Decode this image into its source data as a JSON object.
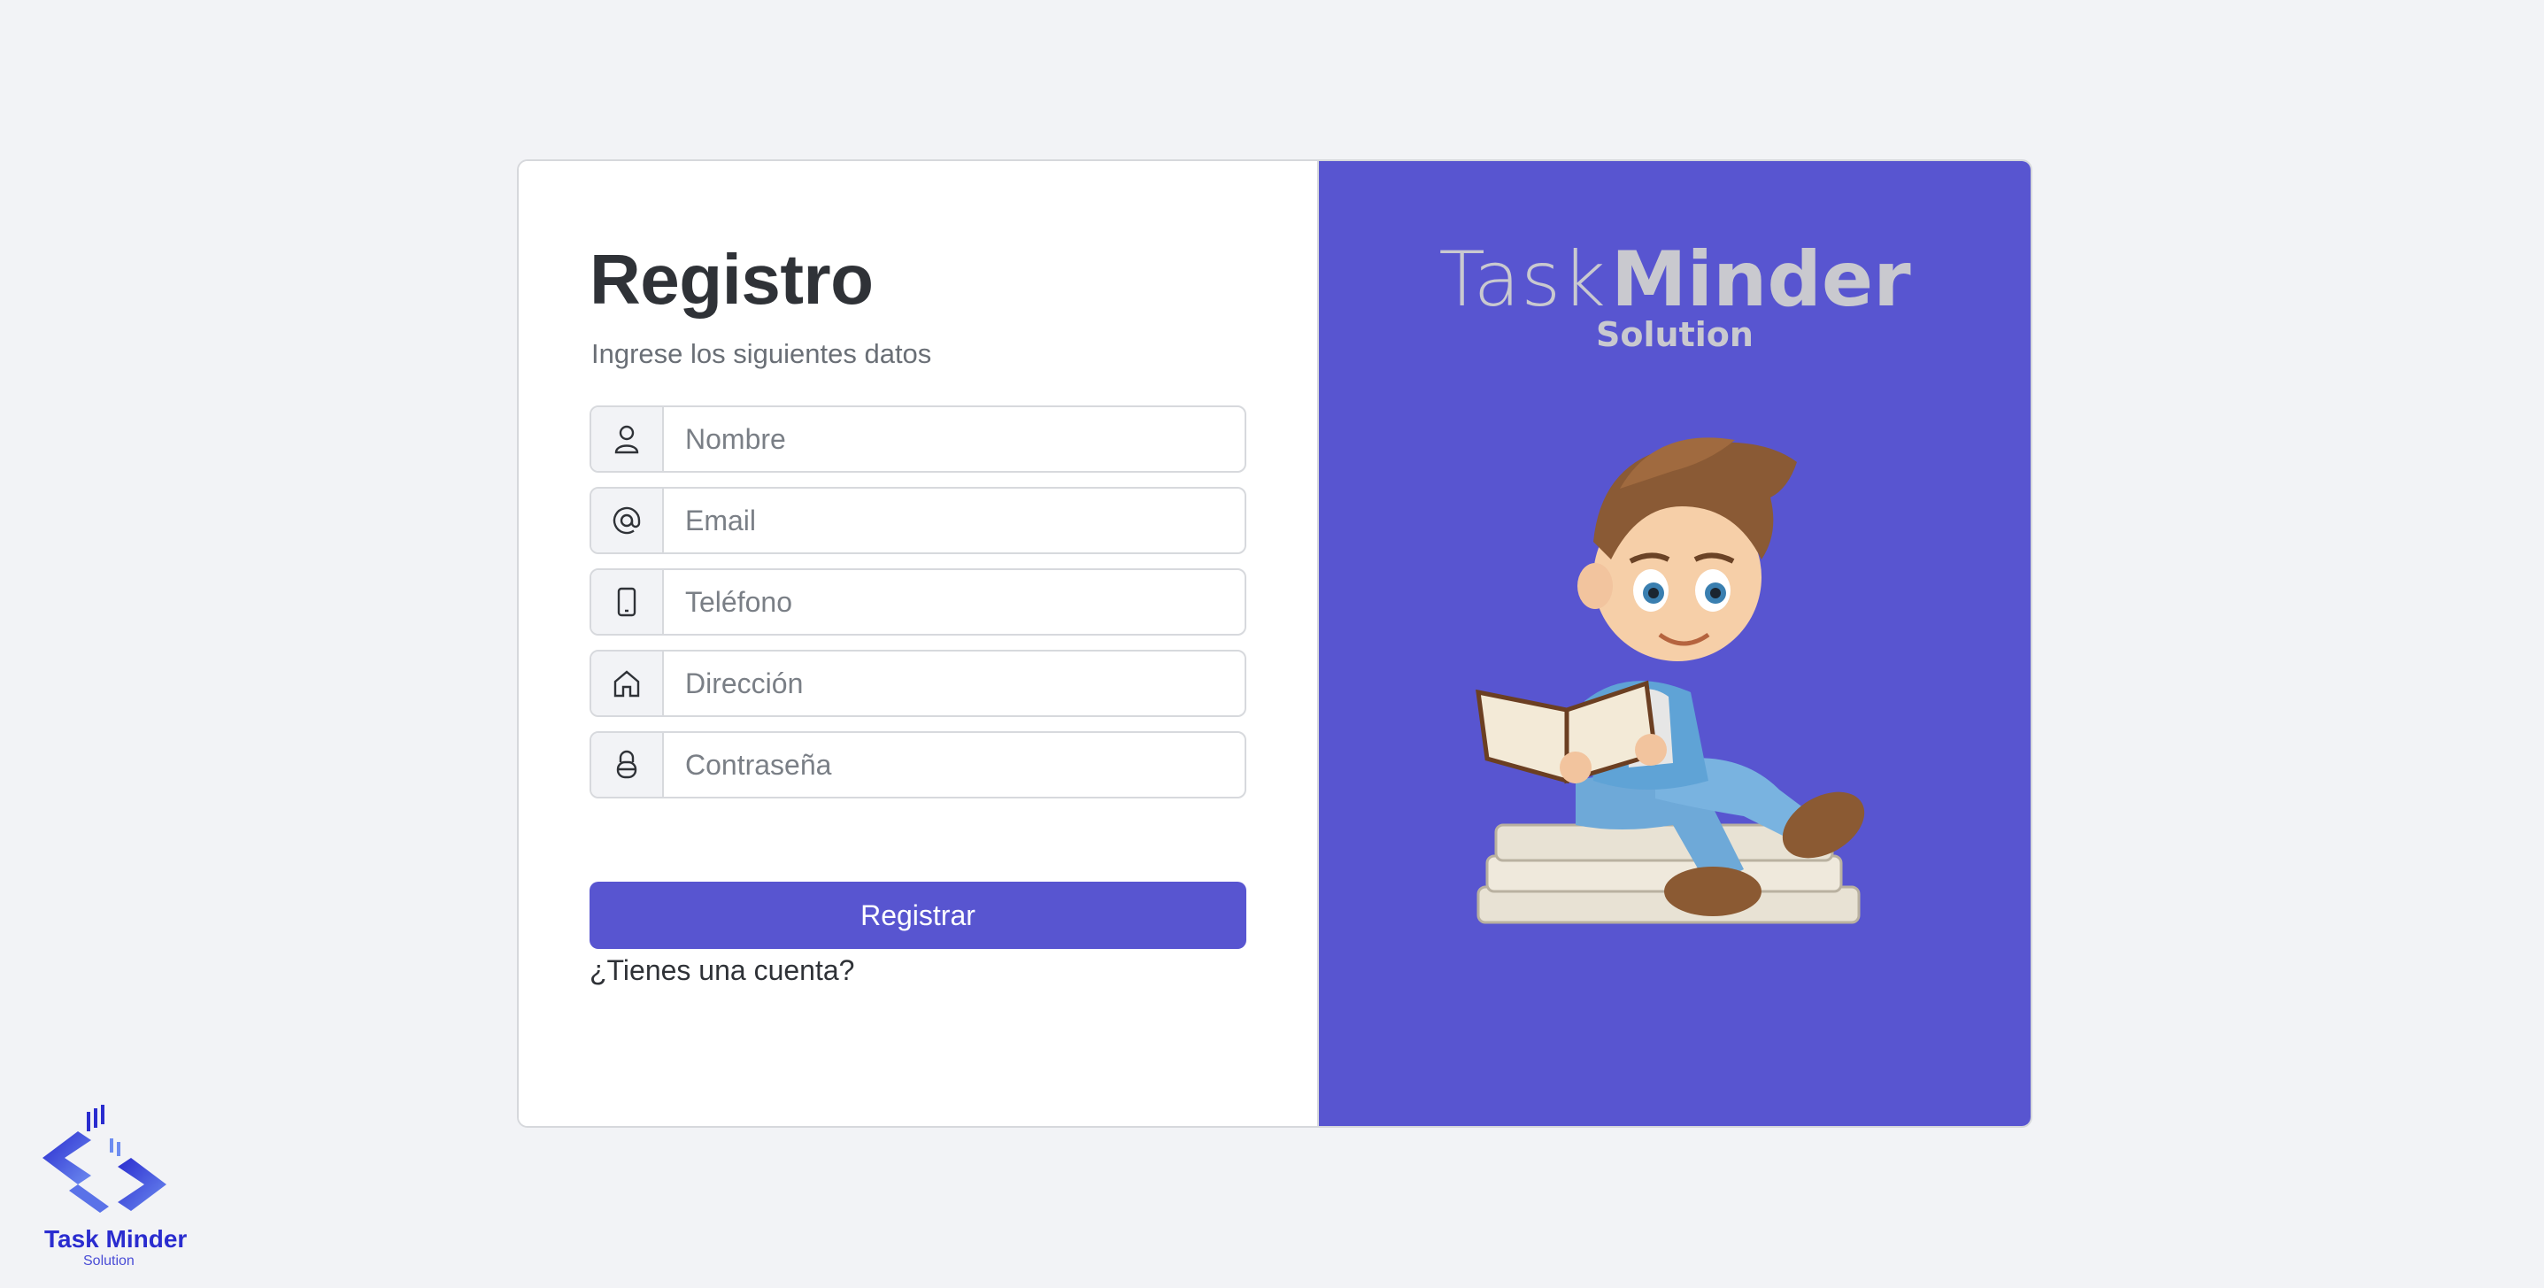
{
  "form": {
    "title": "Registro",
    "subtitle": "Ingrese los siguientes datos",
    "fields": [
      {
        "placeholder": "Nombre",
        "icon": "person-icon"
      },
      {
        "placeholder": "Email",
        "icon": "at-icon"
      },
      {
        "placeholder": "Teléfono",
        "icon": "phone-icon"
      },
      {
        "placeholder": "Dirección",
        "icon": "house-icon"
      },
      {
        "placeholder": "Contraseña",
        "icon": "lock-icon"
      }
    ],
    "submit_label": "Registrar",
    "account_link": "¿Tienes una cuenta?"
  },
  "brand": {
    "word1": "Task",
    "word2": "Minder",
    "sub": "Solution"
  },
  "logo": {
    "title": "Task Minder",
    "sub": "Solution"
  },
  "colors": {
    "accent": "#5855d0",
    "background": "#f2f3f6",
    "logo": "#2a2ccf"
  }
}
